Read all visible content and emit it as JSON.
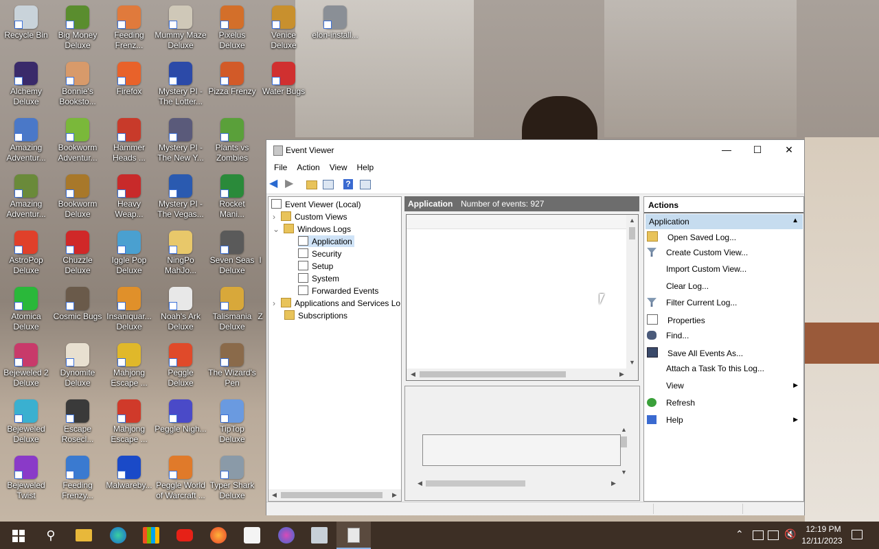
{
  "desktop": {
    "icons": [
      {
        "label": "Recycle Bin",
        "icon": "recycle-bin-icon",
        "color": "#c9d3da"
      },
      {
        "label": "Big Money Deluxe",
        "icon": "money-bag-icon",
        "color": "#5a8d2e"
      },
      {
        "label": "Feeding Frenz...",
        "icon": "fish-icon",
        "color": "#e07a3c"
      },
      {
        "label": "Mummy Maze Deluxe",
        "icon": "mummy-icon",
        "color": "#cfc8b8"
      },
      {
        "label": "Pixelus Deluxe",
        "icon": "pixelus-icon",
        "color": "#d36f2a"
      },
      {
        "label": "Venice Deluxe",
        "icon": "venice-icon",
        "color": "#c8902e"
      },
      {
        "label": "elon-install...",
        "icon": "installer-icon",
        "color": "#8a8f96"
      },
      {
        "label": "Alchemy Deluxe",
        "icon": "alchemy-icon",
        "color": "#3a2a6a"
      },
      {
        "label": "Bonnie's Booksto...",
        "icon": "bonnie-icon",
        "color": "#d89a6a"
      },
      {
        "label": "Firefox",
        "icon": "firefox-icon",
        "color": "#e8622a"
      },
      {
        "label": "Mystery PI - The Lotter...",
        "icon": "mystery-pi-icon",
        "color": "#2c4aa8"
      },
      {
        "label": "Pizza Frenzy",
        "icon": "pizza-icon",
        "color": "#d25a28"
      },
      {
        "label": "Water Bugs",
        "icon": "water-bugs-icon",
        "color": "#d03030"
      },
      {
        "label": "Amazing Adventur...",
        "icon": "amazing-adventures-icon",
        "color": "#4a78c8"
      },
      {
        "label": "Bookworm Adventur...",
        "icon": "bookworm-icon",
        "color": "#7ab83a"
      },
      {
        "label": "Hammer Heads ...",
        "icon": "hammer-heads-icon",
        "color": "#c83a2a"
      },
      {
        "label": "Mystery PI - The New Y...",
        "icon": "mystery-pi-icon",
        "color": "#5a5a7a"
      },
      {
        "label": "Plants vs Zombies",
        "icon": "plants-zombies-icon",
        "color": "#5aa03a"
      },
      {
        "label": "Amazing Adventur...",
        "icon": "amazing-adventures-icon",
        "color": "#6a8a3a"
      },
      {
        "label": "Bookworm Deluxe",
        "icon": "bookworm-icon",
        "color": "#a8782a"
      },
      {
        "label": "Heavy Weap...",
        "icon": "heavy-weapon-icon",
        "color": "#c82a2a"
      },
      {
        "label": "Mystery PI - The Vegas...",
        "icon": "mystery-pi-icon",
        "color": "#2a5ab0"
      },
      {
        "label": "Rocket Mani...",
        "icon": "rocket-icon",
        "color": "#2a8a3a"
      },
      {
        "label": "AstroPop Deluxe",
        "icon": "astropop-icon",
        "color": "#e0402a"
      },
      {
        "label": "Chuzzle Deluxe",
        "icon": "chuzzle-icon",
        "color": "#d02828"
      },
      {
        "label": "Iggle Pop Deluxe",
        "icon": "iggle-pop-icon",
        "color": "#4aa0d0"
      },
      {
        "label": "NingPo MahJo...",
        "icon": "ningpo-icon",
        "color": "#e8c86a"
      },
      {
        "label": "Seven Seas Deluxe",
        "icon": "seven-seas-icon",
        "color": "#5a5a5a"
      },
      {
        "label": "Atomica Deluxe",
        "icon": "atomica-icon",
        "color": "#2ab83a"
      },
      {
        "label": "Cosmic Bugs",
        "icon": "cosmic-bugs-icon",
        "color": "#6a5a4a"
      },
      {
        "label": "Insaniquar... Deluxe",
        "icon": "insaniquarium-icon",
        "color": "#e0902a"
      },
      {
        "label": "Noah's Ark Deluxe",
        "icon": "noahs-ark-icon",
        "color": "#e8e8e8"
      },
      {
        "label": "Talismania Deluxe",
        "icon": "talismania-icon",
        "color": "#d8a83a"
      },
      {
        "label": "Bejeweled 2 Deluxe",
        "icon": "bejeweled-icon",
        "color": "#c83a6a"
      },
      {
        "label": "Dynomite Deluxe",
        "icon": "dynomite-icon",
        "color": "#e8e0d0"
      },
      {
        "label": "Mahjong Escape ...",
        "icon": "mahjong-icon",
        "color": "#e0b82a"
      },
      {
        "label": "Peggle Deluxe",
        "icon": "peggle-icon",
        "color": "#e04a2a"
      },
      {
        "label": "The Wizard's Pen",
        "icon": "wizard-pen-icon",
        "color": "#8a6a4a"
      },
      {
        "label": "Bejeweled Deluxe",
        "icon": "bejeweled-icon",
        "color": "#3ab0d0"
      },
      {
        "label": "Escape Rosecl...",
        "icon": "escape-icon",
        "color": "#3a3a3a"
      },
      {
        "label": "Mahjong Escape ...",
        "icon": "mahjong-icon",
        "color": "#d03a2a"
      },
      {
        "label": "Peggle Nigh...",
        "icon": "peggle-icon",
        "color": "#4a4ac8"
      },
      {
        "label": "TipTop Deluxe",
        "icon": "tiptop-icon",
        "color": "#6a9ae0"
      },
      {
        "label": "Bejeweled Twist",
        "icon": "bejeweled-icon",
        "color": "#8a3ac8"
      },
      {
        "label": "Feeding Frenzy...",
        "icon": "fish-icon",
        "color": "#3a7ad0"
      },
      {
        "label": "Malwareby...",
        "icon": "malwarebytes-icon",
        "color": "#1a4ac8"
      },
      {
        "label": "Peggle World of Warcraft ...",
        "icon": "peggle-icon",
        "color": "#e07a2a"
      },
      {
        "label": "Typer Shark Deluxe",
        "icon": "typer-shark-icon",
        "color": "#8a9aa8"
      }
    ],
    "partial_labels": [
      "I",
      "Z"
    ]
  },
  "window": {
    "title": "Event Viewer",
    "minimize": "—",
    "maximize": "☐",
    "close": "✕",
    "menu": [
      "File",
      "Action",
      "View",
      "Help"
    ],
    "tree": {
      "root": "Event Viewer (Local)",
      "custom_views": "Custom Views",
      "windows_logs": "Windows Logs",
      "logs": [
        "Application",
        "Security",
        "Setup",
        "System",
        "Forwarded Events"
      ],
      "app_services": "Applications and Services Lo",
      "subscriptions": "Subscriptions",
      "selected": "Application"
    },
    "center": {
      "log_name": "Application",
      "events_label": "Number of events: 927"
    },
    "actions": {
      "header": "Actions",
      "section": "Application",
      "items": [
        {
          "label": "Open Saved Log...",
          "icon": "open-folder-icon"
        },
        {
          "label": "Create Custom View...",
          "icon": "funnel-icon"
        },
        {
          "label": "Import Custom View...",
          "icon": ""
        },
        {
          "label": "Clear Log...",
          "icon": ""
        },
        {
          "label": "Filter Current Log...",
          "icon": "funnel-icon"
        },
        {
          "label": "Properties",
          "icon": "properties-icon"
        },
        {
          "label": "Find...",
          "icon": "binoculars-icon"
        },
        {
          "label": "Save All Events As...",
          "icon": "save-icon"
        },
        {
          "label": "Attach a Task To this Log...",
          "icon": ""
        },
        {
          "label": "View",
          "icon": "",
          "submenu": true
        },
        {
          "label": "Refresh",
          "icon": "refresh-icon"
        },
        {
          "label": "Help",
          "icon": "help-icon",
          "submenu": true
        }
      ]
    }
  },
  "taskbar": {
    "time": "12:19 PM",
    "date": "12/11/2023"
  },
  "colors": {
    "accent": "#cfe3f7",
    "header_gray": "#6d6d6d",
    "taskbar": "#3d2f25"
  }
}
